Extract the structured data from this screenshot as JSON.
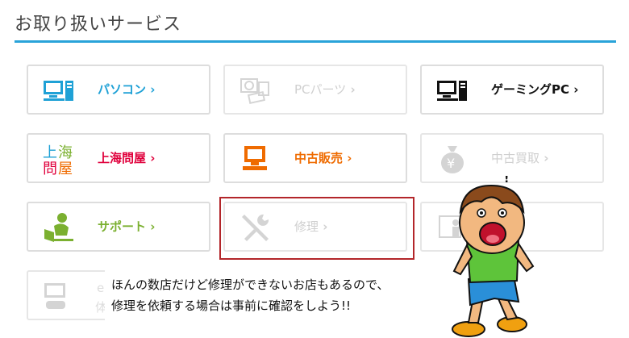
{
  "header": {
    "title": "お取り扱いサービス"
  },
  "services": [
    {
      "label": "パソコン",
      "icon": "desktop-pc-icon",
      "enabled": true
    },
    {
      "label": "PCパーツ",
      "icon": "pc-parts-icon",
      "enabled": false
    },
    {
      "label": "ゲーミングPC",
      "icon": "gaming-pc-icon",
      "enabled": true
    },
    {
      "label": "上海問屋",
      "icon": "shanghai-donya-logo",
      "enabled": true
    },
    {
      "label": "中古販売",
      "icon": "used-pc-icon",
      "enabled": true
    },
    {
      "label": "中古買取",
      "icon": "money-bag-yen-icon",
      "enabled": false
    },
    {
      "label": "サポート",
      "icon": "support-person-icon",
      "enabled": true
    },
    {
      "label": "修理",
      "icon": "repair-tools-icon",
      "enabled": false
    },
    {
      "label": "",
      "icon": "product-display-icon",
      "enabled": false
    },
    {
      "label": "",
      "icon": "game-pc-icon",
      "enabled": false
    }
  ],
  "partial_text": {
    "e_char": "e",
    "ka_char": "体"
  },
  "comment": {
    "line1": "ほんの数店だけど修理ができないお店もあるので、",
    "line2": "修理を依頼する場合は事前に確認をしよう!!"
  },
  "colors": {
    "accent": "#29a3d9",
    "highlight": "#b3262a",
    "red": "#e0003c",
    "orange": "#ef6b00",
    "green": "#7bb030"
  }
}
